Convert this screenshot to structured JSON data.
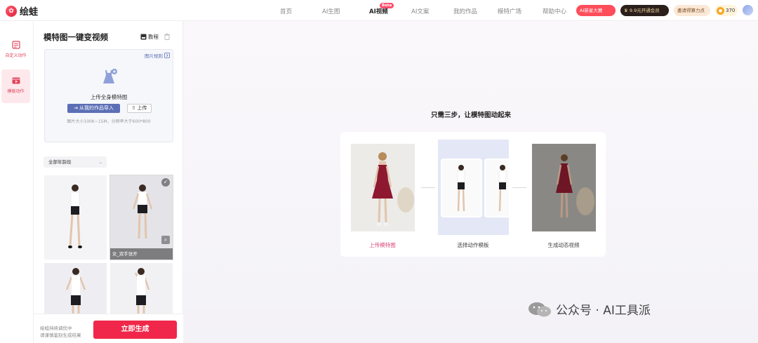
{
  "app": {
    "logo_text": "绘蛙",
    "nav": [
      "首页",
      "AI生图",
      "AI视频",
      "AI文案",
      "我的作品",
      "模特广场",
      "帮助中心"
    ],
    "nav_active_index": 2,
    "beta_badge": "Beta",
    "promo_ai": "AI新星大赛",
    "promo_vip": "9.9元开通会员",
    "promo_invite": "邀请得算力点",
    "coins": "370"
  },
  "rail": [
    {
      "label": "自定义动作",
      "icon": "edit-list-icon",
      "selected": false
    },
    {
      "label": "模板动作",
      "icon": "video-template-icon",
      "selected": true
    }
  ],
  "panel": {
    "title": "模特图一键变视频",
    "tutorial": "教程",
    "image_rules": "图片规则",
    "upload_label": "上传全身模特图",
    "import_button": "从我的作品导入",
    "upload_button": "上传",
    "upload_hint": "图片大小100K~15M，分辨率大于600*800",
    "age_filter": "全部年龄段",
    "thumbnails": [
      {
        "caption": "",
        "selected": false
      },
      {
        "caption": "女_双手张开",
        "selected": true
      },
      {
        "caption": "",
        "selected": false
      },
      {
        "caption": "",
        "selected": false
      }
    ],
    "bottom_hint_1": "绘蛙持续调优中",
    "bottom_hint_2": "请谨慎鉴别生成结果",
    "generate_button": "立即生成"
  },
  "main": {
    "title": "只需三步，让模特图动起来",
    "steps": [
      "上传模特图",
      "选择动作模板",
      "生成动态视频"
    ],
    "active_step": 0
  },
  "watermark": "公众号 · AI工具派",
  "colors": {
    "accent": "#f0274a",
    "import_blue": "#5b6fb5",
    "step_active": "#d8467a",
    "dress": "#8e1830"
  }
}
